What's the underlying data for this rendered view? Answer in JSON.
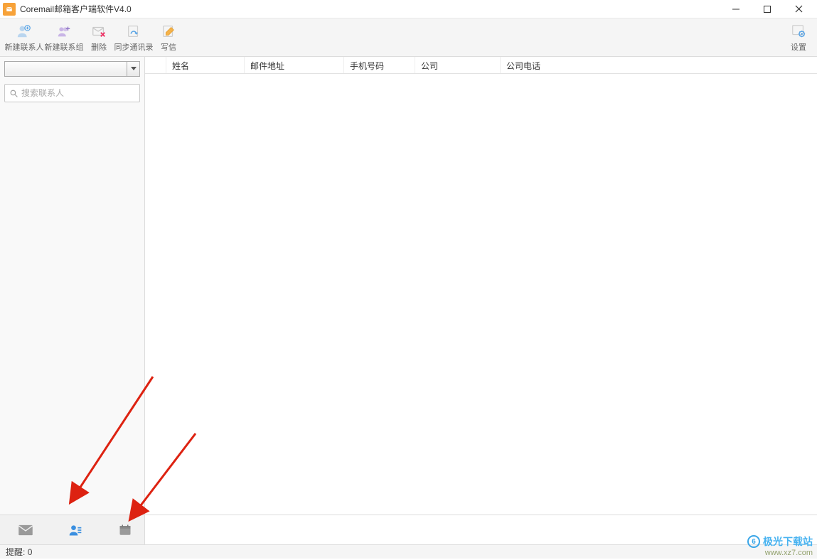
{
  "titlebar": {
    "title": "Coremail邮箱客户端软件V4.0"
  },
  "toolbar": {
    "new_contact": "新建联系人",
    "new_group": "新建联系组",
    "delete": "删除",
    "sync": "同步通讯录",
    "compose": "写信",
    "settings": "设置"
  },
  "sidebar": {
    "search_placeholder": "搜索联系人"
  },
  "table": {
    "columns": [
      "",
      "姓名",
      "邮件地址",
      "手机号码",
      "公司",
      "公司电话"
    ]
  },
  "statusbar": {
    "reminder_label": "提醒:",
    "reminder_count": "0"
  },
  "watermark": {
    "brand": "极光下载站",
    "url": "www.xz7.com"
  }
}
